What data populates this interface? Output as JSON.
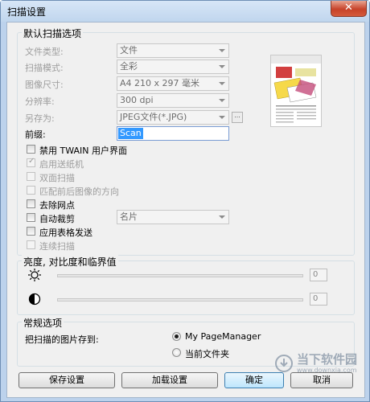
{
  "window": {
    "title": "扫描设置",
    "close_symbol": "✕"
  },
  "default_options": {
    "group_title": "默认扫描选项",
    "file_type": {
      "label": "文件类型:",
      "value": "文件"
    },
    "scan_mode": {
      "label": "扫描模式:",
      "value": "全彩"
    },
    "image_size": {
      "label": "图像尺寸:",
      "value": "A4 210 x 297 毫米"
    },
    "resolution": {
      "label": "分辨率:",
      "value": "300  dpi"
    },
    "save_as": {
      "label": "另存为:",
      "value": "JPEG文件(*.JPG)",
      "more": "..."
    },
    "prefix": {
      "label": "前缀:",
      "value": "Scan"
    },
    "checkboxes": [
      {
        "label": "禁用 TWAIN 用户界面",
        "checked": false,
        "enabled": true
      },
      {
        "label": "启用送纸机",
        "checked": true,
        "enabled": false
      },
      {
        "label": "双面扫描",
        "checked": false,
        "enabled": false
      },
      {
        "label": "匹配前后图像的方向",
        "checked": false,
        "enabled": false
      },
      {
        "label": "去除网点",
        "checked": false,
        "enabled": true
      },
      {
        "label": "自动裁剪",
        "checked": false,
        "enabled": true
      },
      {
        "label": "应用表格发送",
        "checked": false,
        "enabled": true
      },
      {
        "label": "连续扫描",
        "checked": false,
        "enabled": false
      }
    ],
    "crop_combo": "名片",
    "preview": {
      "heading": "PageManager",
      "subheading": "The Scanning 3D"
    }
  },
  "brightness": {
    "group_title": "亮度, 对比度和临界值",
    "brightness_value": "0",
    "contrast_value": "0"
  },
  "general": {
    "group_title": "常规选项",
    "save_to_label": "把扫描的图片存到:",
    "radio_options": [
      {
        "label": "My PageManager",
        "selected": true
      },
      {
        "label": "当前文件夹",
        "selected": false
      }
    ]
  },
  "buttons": {
    "save_settings": "保存设置",
    "load_settings": "加载设置",
    "ok": "确定",
    "cancel": "取消"
  },
  "watermark": {
    "text": "当下软件园",
    "url": "www.downxia.com"
  }
}
